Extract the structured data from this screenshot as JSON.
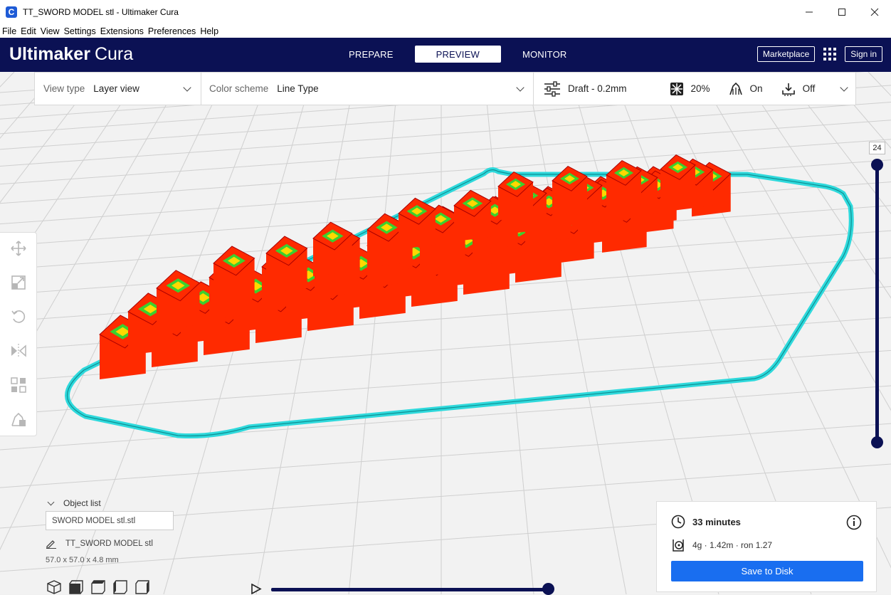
{
  "window": {
    "title": "TT_SWORD MODEL stl - Ultimaker Cura",
    "app_icon": "C",
    "controls": [
      "minimize-icon",
      "maximize-icon",
      "close-icon"
    ]
  },
  "menu": [
    "File",
    "Edit",
    "View",
    "Settings",
    "Extensions",
    "Preferences",
    "Help"
  ],
  "header": {
    "logo_bold": "Ultimaker",
    "logo_thin": "Cura",
    "tabs": [
      {
        "label": "PREPARE",
        "active": false
      },
      {
        "label": "PREVIEW",
        "active": true
      },
      {
        "label": "MONITOR",
        "active": false
      }
    ],
    "marketplace": "Marketplace",
    "sign_in": "Sign in"
  },
  "toolbar": {
    "view_type_label": "View type",
    "view_type_value": "Layer view",
    "color_scheme_label": "Color scheme",
    "color_scheme_value": "Line Type",
    "profile": "Draft - 0.2mm",
    "infill": "20%",
    "support": "On",
    "adhesion": "Off"
  },
  "layer_slider": {
    "current_layer": "24"
  },
  "object_list": {
    "header": "Object list",
    "field_value": "SWORD MODEL stl.stl",
    "object_name": "TT_SWORD MODEL stl",
    "dimensions": "57.0 x 57.0 x 4.8 mm"
  },
  "print_info": {
    "time": "33 minutes",
    "material": "4g · 1.42m · ron 1.27",
    "save_label": "Save to Disk"
  },
  "colors": {
    "header_bg": "#0b1154",
    "accent": "#196ef0",
    "wall": "#ff2a00",
    "infill": "#ffd800",
    "skin": "#3bd02f",
    "skirt": "#2fd9dc"
  }
}
